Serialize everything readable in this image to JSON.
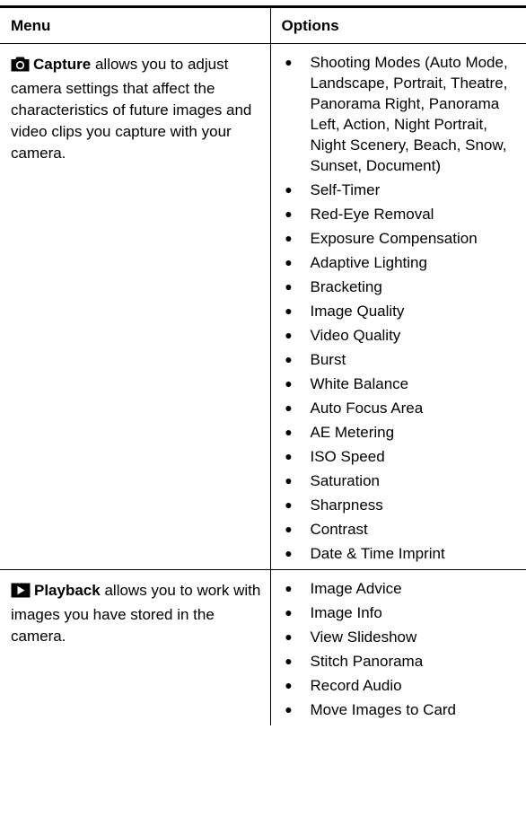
{
  "header": {
    "menu_label": "Menu",
    "options_label": "Options"
  },
  "rows": [
    {
      "icon": "camera-icon",
      "name": "Capture",
      "description": " allows you to adjust camera settings that affect the characteristics of future images and video clips you capture with your camera.",
      "options": [
        "Shooting Modes (Auto Mode, Landscape, Portrait, Theatre, Panorama Right, Panorama Left, Action, Night Portrait, Night Scenery, Beach, Snow, Sunset, Document)",
        "Self-Timer",
        "Red-Eye Removal",
        "Exposure Compensation",
        "Adaptive Lighting",
        "Bracketing",
        "Image Quality",
        "Video Quality",
        "Burst",
        "White Balance",
        "Auto Focus Area",
        "AE Metering",
        "ISO Speed",
        "Saturation",
        "Sharpness",
        "Contrast",
        "Date & Time Imprint"
      ]
    },
    {
      "icon": "playback-icon",
      "name": "Playback",
      "description": " allows you to work with images you have stored in the camera.",
      "options": [
        "Image Advice",
        "Image Info",
        "View Slideshow",
        "Stitch Panorama",
        "Record Audio",
        "Move Images to Card"
      ]
    }
  ],
  "bullet_symbol": "●"
}
